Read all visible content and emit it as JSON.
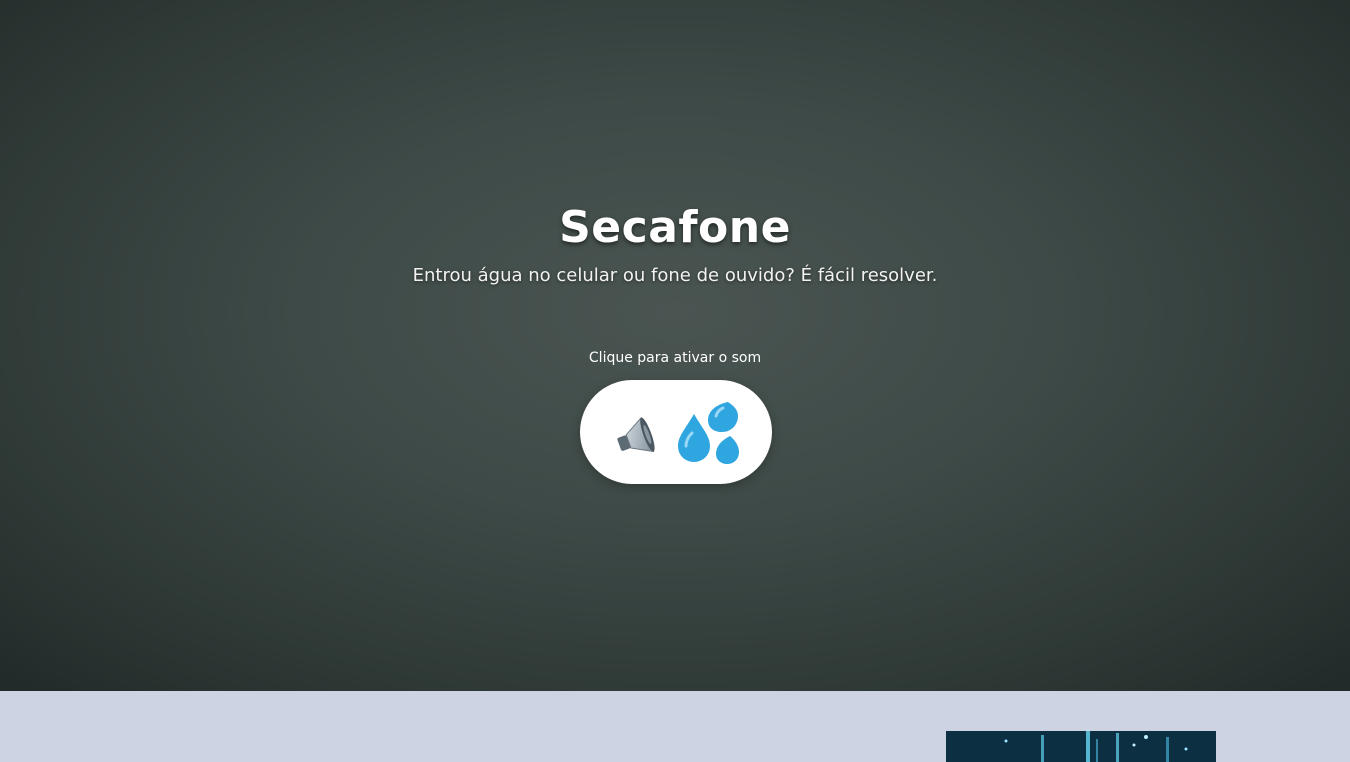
{
  "hero": {
    "title": "Secafone",
    "subtitle": "Entrou água no celular ou fone de ouvido? É fácil resolver.",
    "sound_caption": "Clique para ativar o som",
    "button_icons": [
      "speaker-icon",
      "droplets-icon"
    ]
  },
  "colors": {
    "hero_background": "#3e4a47",
    "lower_background": "#cdd3e2",
    "button_background": "#ffffff",
    "droplet_blue": "#2fa6e0"
  }
}
